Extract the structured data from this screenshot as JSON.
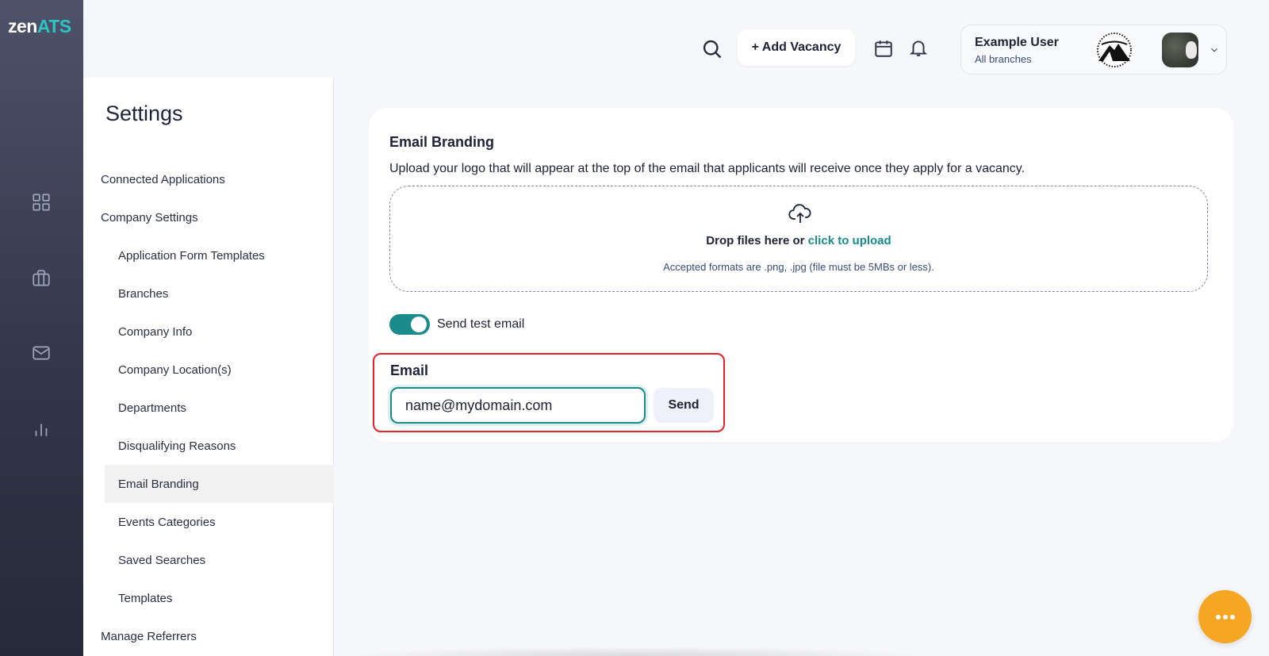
{
  "app": {
    "logo_main": "zen",
    "logo_accent": "ATS"
  },
  "rail": {
    "icons": [
      "dashboard-icon",
      "briefcase-icon",
      "mail-icon",
      "chart-icon"
    ]
  },
  "header": {
    "add_vacancy_label": "+ Add Vacancy",
    "user": {
      "name": "Example User",
      "branch": "All branches"
    }
  },
  "settings": {
    "title": "Settings",
    "menu": [
      {
        "label": "Connected Applications",
        "level": 1
      },
      {
        "label": "Company Settings",
        "level": 1
      },
      {
        "label": "Application Form Templates",
        "level": 2
      },
      {
        "label": "Branches",
        "level": 2
      },
      {
        "label": "Company Info",
        "level": 2
      },
      {
        "label": "Company Location(s)",
        "level": 2
      },
      {
        "label": "Departments",
        "level": 2
      },
      {
        "label": "Disqualifying Reasons",
        "level": 2
      },
      {
        "label": "Email Branding",
        "level": 2,
        "active": true
      },
      {
        "label": "Events Categories",
        "level": 2
      },
      {
        "label": "Saved Searches",
        "level": 2
      },
      {
        "label": "Templates",
        "level": 2
      },
      {
        "label": "Manage Referrers",
        "level": 1
      }
    ]
  },
  "branding": {
    "title": "Email Branding",
    "description": "Upload your logo that will appear at the top of the email that applicants will receive once they apply for a vacancy.",
    "drop_text": "Drop files here or ",
    "drop_link": "click to upload",
    "formats": "Accepted formats are .png, .jpg (file must be 5MBs or less).",
    "toggle_label": "Send test email",
    "toggle_on": true,
    "email_label": "Email",
    "email_value": "name@mydomain.com",
    "send_label": "Send"
  },
  "colors": {
    "accent": "#1a8a8a",
    "highlight": "#e4232b",
    "fab": "#f5a623"
  }
}
